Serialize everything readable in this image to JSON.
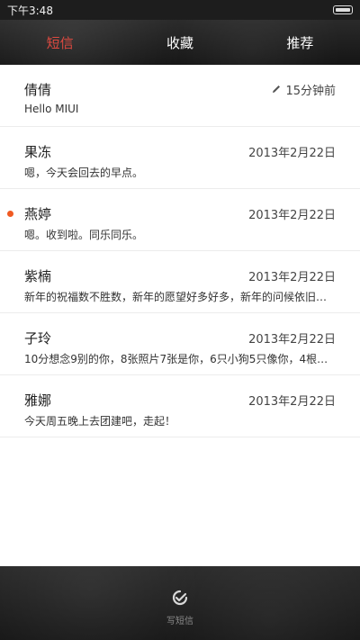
{
  "status_bar": {
    "time": "下午3:48"
  },
  "tabs": [
    {
      "label": "短信",
      "active": true
    },
    {
      "label": "收藏",
      "active": false
    },
    {
      "label": "推荐",
      "active": false
    }
  ],
  "conversations": [
    {
      "name": "倩倩",
      "date": "15分钟前",
      "preview": "Hello MIUI",
      "unread": false,
      "draft": true
    },
    {
      "name": "果冻",
      "date": "2013年2月22日",
      "preview": "嗯，今天会回去的早点。",
      "unread": false,
      "draft": false
    },
    {
      "name": "燕婷",
      "date": "2013年2月22日",
      "preview": "嗯。收到啦。同乐同乐。",
      "unread": true,
      "draft": false
    },
    {
      "name": "紫楠",
      "date": "2013年2月22日",
      "preview": "新年的祝福数不胜数，新年的愿望好多好多，新年的问候依旧美好…",
      "unread": false,
      "draft": false
    },
    {
      "name": "子玲",
      "date": "2013年2月22日",
      "preview": "10分想念9别的你，8张照片7张是你，6只小狗5只像你，4根骨头…",
      "unread": false,
      "draft": false
    },
    {
      "name": "雅娜",
      "date": "2013年2月22日",
      "preview": "今天周五晚上去团建吧，走起！",
      "unread": false,
      "draft": false
    }
  ],
  "footer": {
    "compose_label": "写短信"
  },
  "colors": {
    "accent": "#e04a40",
    "unread": "#f05a22"
  }
}
